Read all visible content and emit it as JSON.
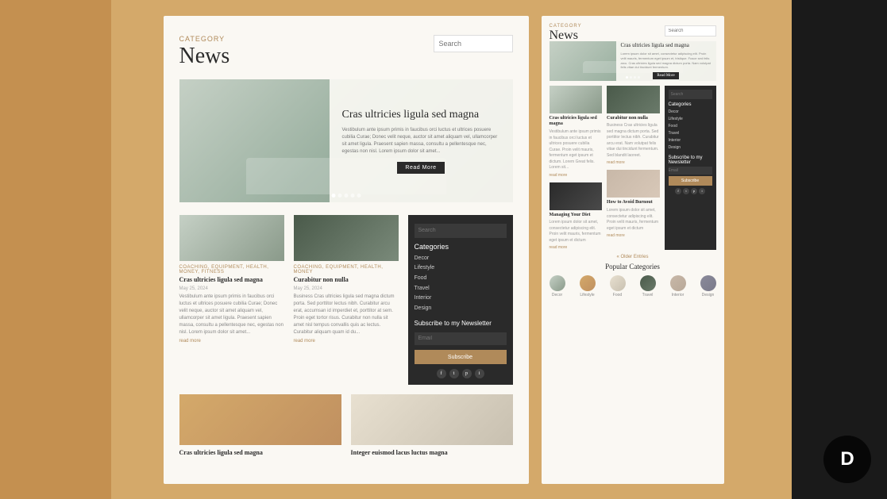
{
  "background": {
    "color": "#d4a96a"
  },
  "left_preview": {
    "category_label": "Category",
    "title": "News",
    "search_placeholder": "Search",
    "hero": {
      "title": "Cras ultricies ligula sed magna",
      "description": "Vestibulum ante ipsum primis in faucibus orci luctus et ultrices posuere cubilia Curae; Donec velit neque, auctor sit amet aliquam vel, ullamcorper sit amet ligula. Praesent sapien massa, consultu a pellentesque nec, egestas non nisl. Lorem ipsum dolor sit amet...",
      "button_label": "Read More",
      "dots": [
        "active",
        "",
        "",
        "",
        ""
      ]
    },
    "cards": [
      {
        "category": "Coaching, Equipment, Health, Money, Fitness",
        "title": "Cras ultricies ligula sed magna",
        "date": "May 25, 2024",
        "text": "Vestibulum ante ipsum primis in faucibus orci luctus et ultrices posuere cubilia Curae; Donec velit neque, auctor sit amet aliquam vel, ullamcorper sit amet ligula. Praesent sapien massa, consultu a pellentesque nec, egestas non nisl. Lorem ipsum dolor sit amet...",
        "read_more": "read more",
        "img_type": "sofa"
      },
      {
        "category": "Coaching, Equipment, Health, Money",
        "title": "Curabitur non nulla",
        "date": "May 25, 2024",
        "text": "Business Cras ultricies ligula sed magna dictum porta. Sed porttitor lectus nibh. Curabitur arcu erat, accumsan id imperdiet et, porttitor at sem. Proin eget tortor risus. Curabitur non nulla sit amet nisl tempus convallis quis ac lectus. Curabitur aliquam quam id du...",
        "read_more": "read more",
        "img_type": "shelves"
      }
    ],
    "sidebar": {
      "search_placeholder": "Search",
      "categories_label": "Categories",
      "categories": [
        "Decor",
        "Lifestyle",
        "Food",
        "Travel",
        "Interior",
        "Design"
      ],
      "newsletter": {
        "title": "Subscribe to my Newsletter",
        "email_placeholder": "Email",
        "button_label": "Subscribe"
      },
      "social": [
        "f",
        "t",
        "p",
        "i"
      ]
    },
    "cards_row2": [
      {
        "title": "Cras ultricies ligula sed magna",
        "img_type": "woman"
      },
      {
        "title": "Integer euismod lacus luctus magna",
        "img_type": "room"
      }
    ]
  },
  "right_preview": {
    "category_label": "Category",
    "title": "News",
    "search_placeholder": "Search",
    "hero": {
      "title": "Cras ultricies ligula sed magna",
      "description": "Lorem ipsum dolor sit amet, consectetur adipiscing elit. Proin velit mauris, fermentum eget ipsum et, tristique. Fusce sed felis arcu. Cras ultricies ligula sed magna dictum porta. Nam volutpat felis vitae dui tincidunt fermentum.",
      "button_label": "Read More",
      "dots": [
        "active",
        "",
        "",
        "",
        ""
      ]
    },
    "cards_top": [
      {
        "title": "Cras ultricies ligula sed magna",
        "text": "Vestibulum ante ipsum primis in faucibus orci luctus et ultrices posuere cubilia Curae. Proin velit mauris, fermentum eget ipsum et dictum. Lorem Great felis. Lorem sit...",
        "read_more": "read more",
        "img_type": "rp-sofa"
      },
      {
        "title": "Curabitur non nulla",
        "text": "Business Cras ultricies ligula sed magna dictum porta. Sed porttitor lectus nibh. Curabitur arcu erat. Nam volutpat felis vitae dui tincidunt fermentum. Sed blandit laoreet.",
        "read_more": "read more",
        "img_type": "rp-shelves"
      }
    ],
    "cards_bottom": [
      {
        "title": "Managing Your Diet",
        "text": "Lorem ipsum dolor sit amet, consectetur adipiscing elit. Proin velit mauris, fermentum eget ipsum et dictum",
        "read_more": "read more",
        "img_type": "rp-phone"
      },
      {
        "title": "How to Avoid Burnout",
        "text": "Lorem ipsum dolor sit amet, consectetur adipiscing elit. Proin velit mauris, fermentum eget ipsum et dictum",
        "read_more": "read more",
        "img_type": "rp-interior"
      }
    ],
    "sidebar": {
      "search_placeholder": "Search",
      "categories_label": "Categories",
      "categories": [
        "Decor",
        "Lifestyle",
        "Food",
        "Travel",
        "Interior",
        "Design"
      ],
      "newsletter": {
        "title": "Subscribe to my Newsletter",
        "email_placeholder": "Email",
        "button_label": "Subscribe"
      },
      "social": [
        "f",
        "t",
        "p",
        "i"
      ]
    },
    "older_entries": "« Older Entries",
    "popular_categories": {
      "title": "Popular Categories",
      "items": [
        {
          "label": "Decor",
          "circle_class": "circle-decor"
        },
        {
          "label": "Lifestyle",
          "circle_class": "circle-lifestyle"
        },
        {
          "label": "Food",
          "circle_class": "circle-food"
        },
        {
          "label": "Travel",
          "circle_class": "circle-travel"
        },
        {
          "label": "Interior",
          "circle_class": "circle-interior"
        },
        {
          "label": "Design",
          "circle_class": "circle-design"
        }
      ]
    }
  },
  "divi": {
    "label": "D"
  }
}
